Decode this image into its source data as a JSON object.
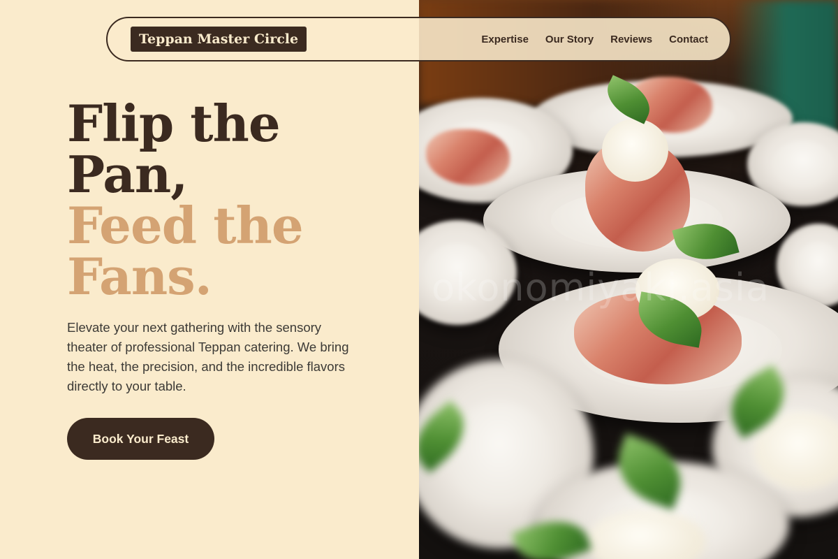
{
  "brand": {
    "name": "Teppan Master Circle"
  },
  "nav": {
    "items": [
      {
        "label": "Expertise"
      },
      {
        "label": "Our Story"
      },
      {
        "label": "Reviews"
      },
      {
        "label": "Contact"
      }
    ]
  },
  "hero": {
    "headline_line1": "Flip the",
    "headline_line2": "Pan,",
    "headline_line3": "Feed the",
    "headline_line4": "Fans.",
    "description": "Elevate your next gathering with the sensory theater of professional Teppan catering. We bring the heat, the precision, and the incredible flavors directly to your table.",
    "cta_label": "Book Your Feast",
    "image_watermark": "okonomiyaki.asia"
  },
  "colors": {
    "background": "#FAEBCC",
    "dark_brown": "#3b2a20",
    "accent_tan": "#d4a373"
  }
}
